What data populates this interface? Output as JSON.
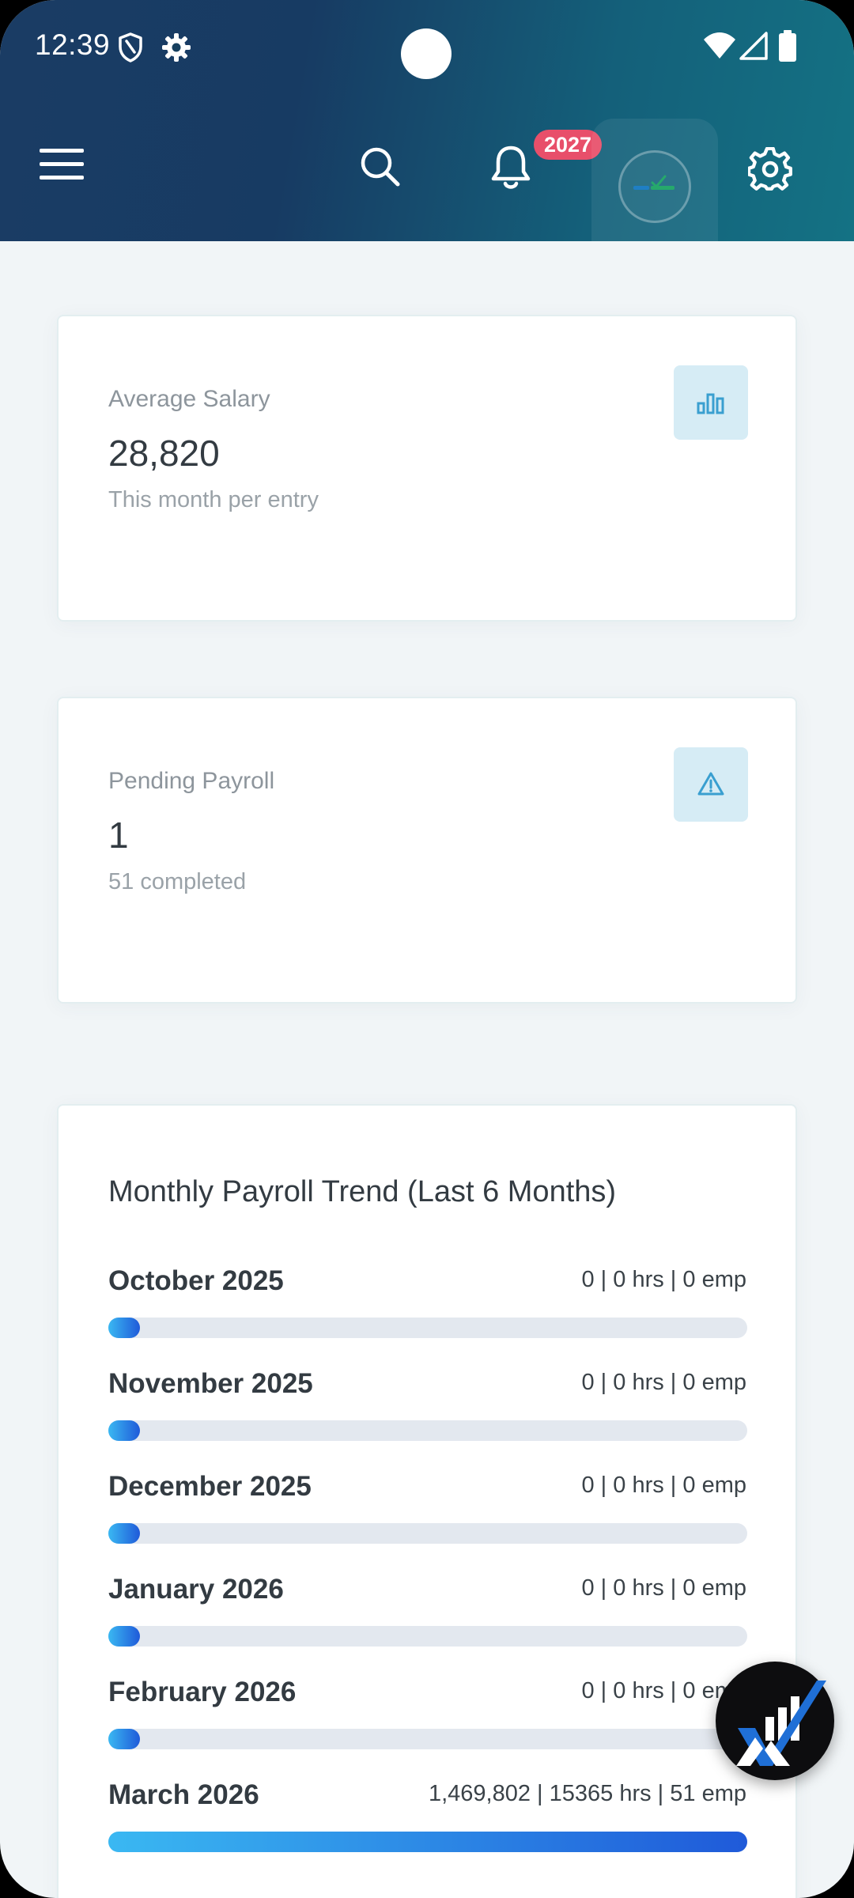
{
  "status_bar": {
    "time": "12:39",
    "icons": [
      "shield-icon",
      "gear-icon",
      "wifi-icon",
      "signal-icon",
      "battery-icon"
    ]
  },
  "toolbar": {
    "icons": [
      "menu-icon",
      "search-icon",
      "bell-icon",
      "avatar",
      "settings-icon"
    ],
    "notification_count": "2027"
  },
  "cards": {
    "average_salary": {
      "label": "Average Salary",
      "value": "28,820",
      "sub": "This month per entry",
      "icon": "bar-chart-icon"
    },
    "pending_payroll": {
      "label": "Pending Payroll",
      "value": "1",
      "sub": "51 completed",
      "icon": "warning-icon"
    }
  },
  "trend": {
    "title": "Monthly Payroll Trend (Last 6 Months)",
    "rows": [
      {
        "month": "October 2025",
        "stats": "0 | 0 hrs | 0 emp",
        "fill": 0.05
      },
      {
        "month": "November 2025",
        "stats": "0 | 0 hrs | 0 emp",
        "fill": 0.05
      },
      {
        "month": "December 2025",
        "stats": "0 | 0 hrs | 0 emp",
        "fill": 0.05
      },
      {
        "month": "January 2026",
        "stats": "0 | 0 hrs | 0 emp",
        "fill": 0.05
      },
      {
        "month": "February 2026",
        "stats": "0 | 0 hrs | 0 emp",
        "fill": 0.05
      },
      {
        "month": "March 2026",
        "stats": "1,469,802 | 15365 hrs | 51 emp",
        "fill": 1.0
      }
    ]
  },
  "colors": {
    "header_start": "#1a3c64",
    "header_end": "#147284",
    "badge": "#e84f6a",
    "bar_start": "#3ab8f2",
    "bar_end": "#1f5ad9",
    "icon_accent": "#3a9fd0"
  },
  "fab": {
    "icon": "logo-checkmark-icon"
  }
}
